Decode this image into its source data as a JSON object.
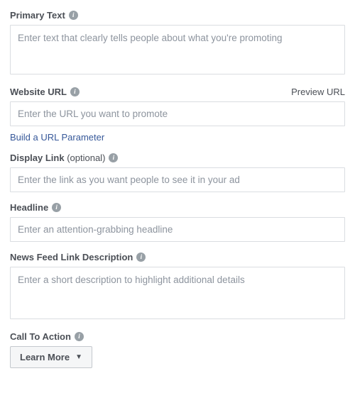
{
  "primaryText": {
    "label": "Primary Text",
    "placeholder": "Enter text that clearly tells people about what you're promoting"
  },
  "websiteUrl": {
    "label": "Website URL",
    "previewLink": "Preview URL",
    "placeholder": "Enter the URL you want to promote",
    "buildParam": "Build a URL Parameter"
  },
  "displayLink": {
    "label": "Display Link",
    "optional": "(optional)",
    "placeholder": "Enter the link as you want people to see it in your ad"
  },
  "headline": {
    "label": "Headline",
    "placeholder": "Enter an attention-grabbing headline"
  },
  "newsFeedDesc": {
    "label": "News Feed Link Description",
    "placeholder": "Enter a short description to highlight additional details"
  },
  "cta": {
    "label": "Call To Action",
    "selected": "Learn More"
  }
}
